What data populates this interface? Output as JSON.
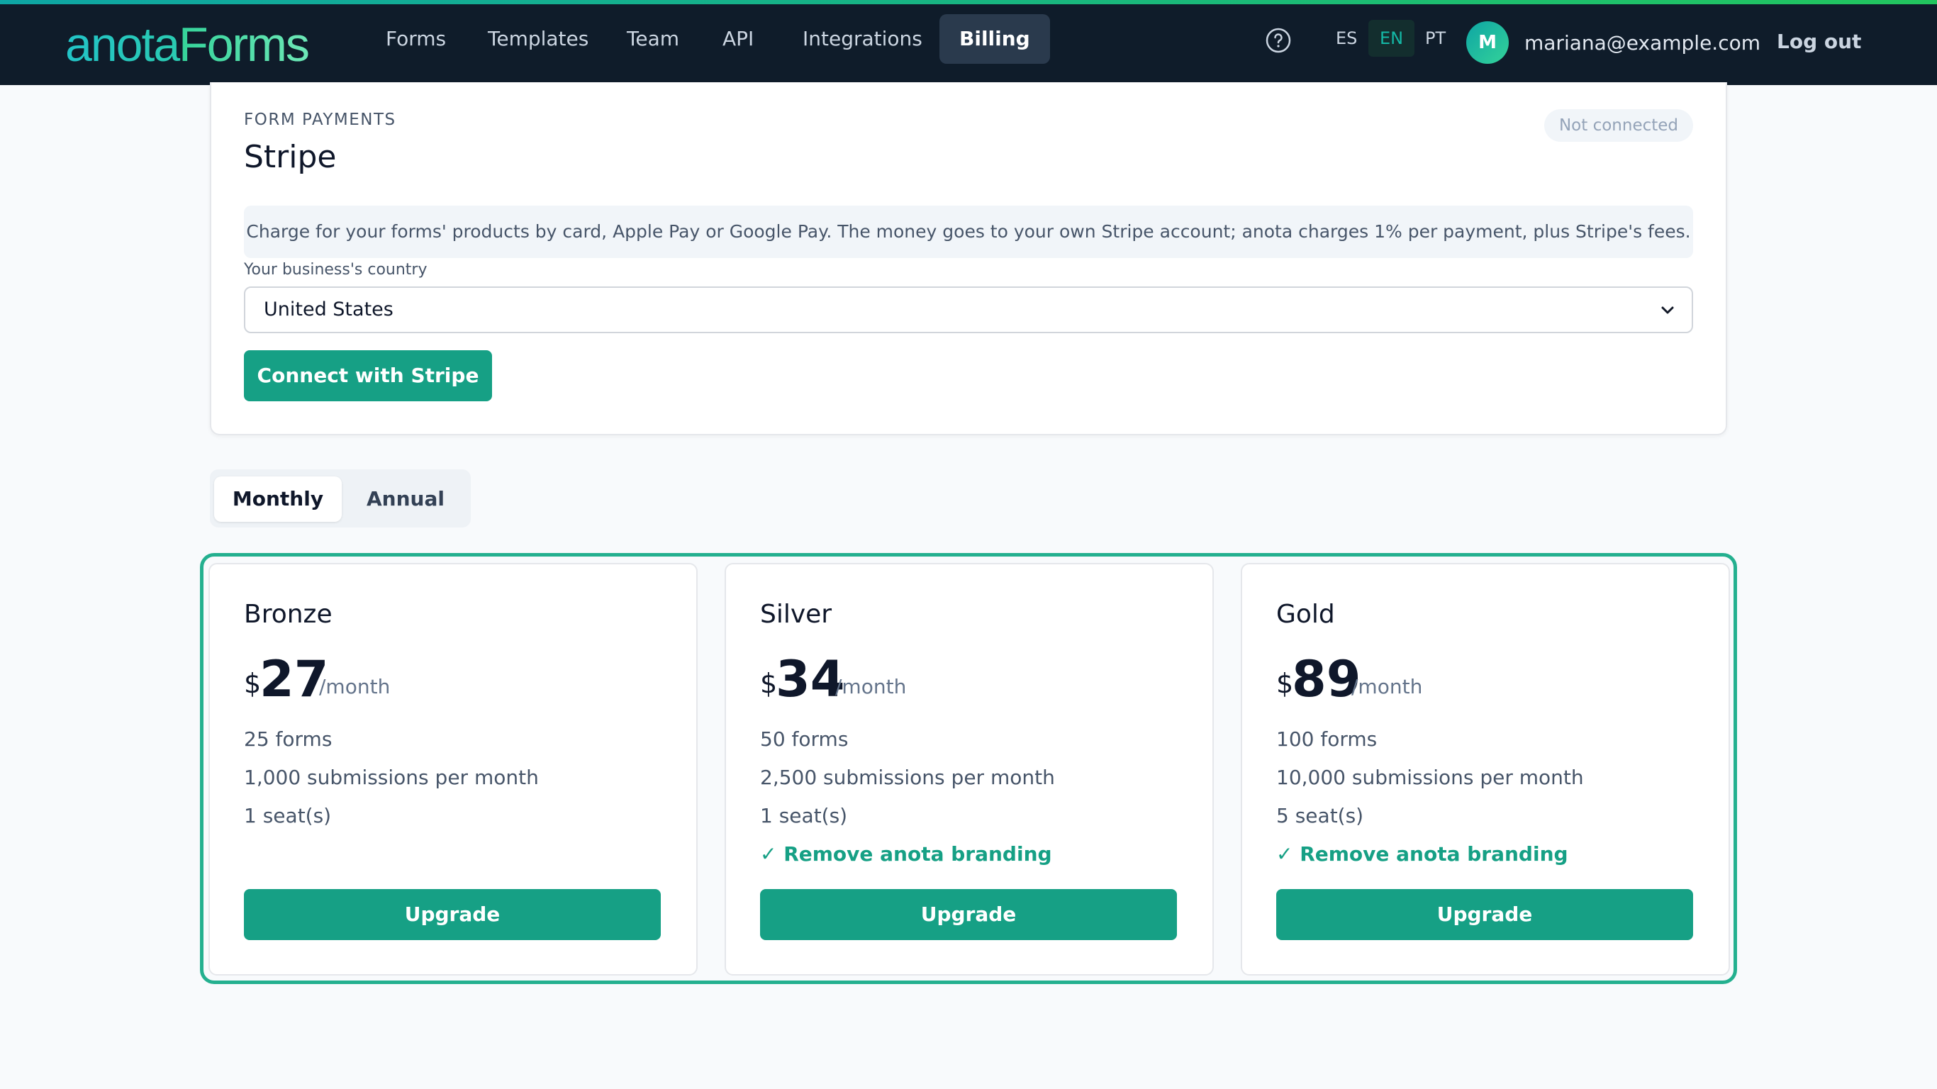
{
  "header": {
    "logo_part1": "anota",
    "logo_part2": "Forms",
    "nav": [
      "Forms",
      "Templates",
      "Team",
      "API",
      "Integrations",
      "Billing"
    ],
    "active_nav": "Billing",
    "languages": [
      "ES",
      "EN",
      "PT"
    ],
    "active_language": "EN",
    "avatar_initial": "M",
    "user_email": "mariana@example.com",
    "logout_label": "Log out"
  },
  "stripe": {
    "eyebrow": "FORM PAYMENTS",
    "title": "Stripe",
    "status": "Not connected",
    "info": "Charge for your forms' products by card, Apple Pay or Google Pay. The money goes to your own Stripe account; anota charges 1% per payment, plus Stripe's fees.",
    "country_label": "Your business's country",
    "country_value": "United States",
    "connect_label": "Connect with Stripe"
  },
  "billing_toggle": {
    "options": [
      "Monthly",
      "Annual"
    ],
    "selected": "Monthly"
  },
  "plans": [
    {
      "name": "Bronze",
      "currency": "$",
      "price": "27",
      "period": "/month",
      "features": [
        "25 forms",
        "1,000 submissions per month",
        "1 seat(s)"
      ],
      "extra": "",
      "button": "Upgrade"
    },
    {
      "name": "Silver",
      "currency": "$",
      "price": "34",
      "period": "/month",
      "features": [
        "50 forms",
        "2,500 submissions per month",
        "1 seat(s)"
      ],
      "extra": "✓ Remove anota branding",
      "button": "Upgrade"
    },
    {
      "name": "Gold",
      "currency": "$",
      "price": "89",
      "period": "/month",
      "features": [
        "100 forms",
        "10,000 submissions per month",
        "5 seat(s)"
      ],
      "extra": "✓ Remove anota branding",
      "button": "Upgrade"
    }
  ],
  "colors": {
    "accent": "#16a085",
    "header_bg": "#0f1c2a",
    "plan_border": "#24b08f"
  }
}
